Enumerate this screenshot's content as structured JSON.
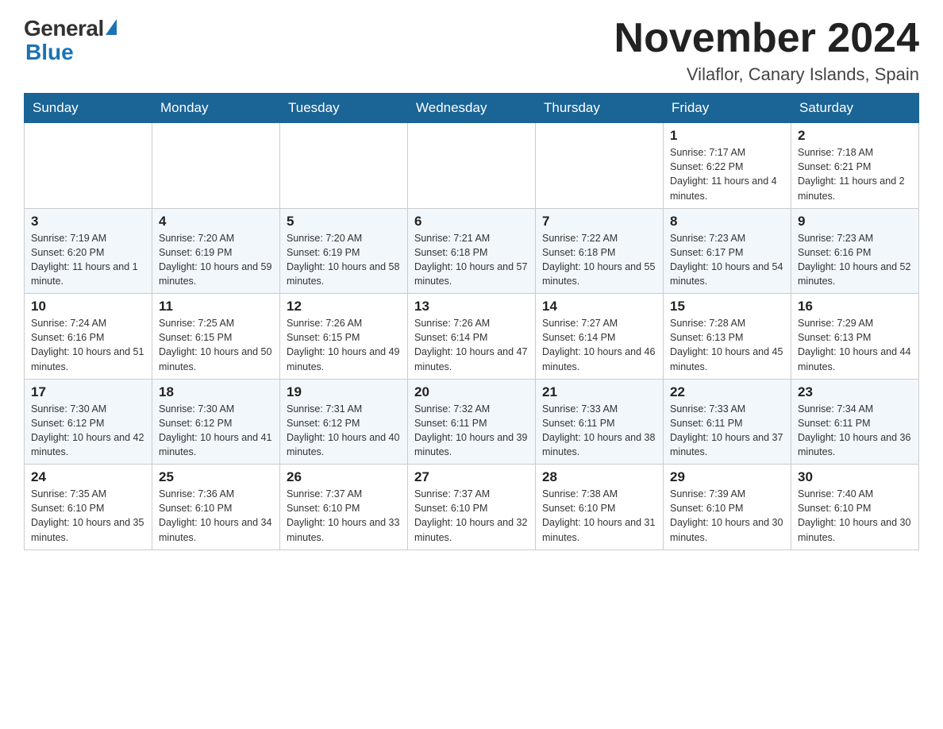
{
  "header": {
    "logo_general": "General",
    "logo_blue": "Blue",
    "title": "November 2024",
    "subtitle": "Vilaflor, Canary Islands, Spain"
  },
  "weekdays": [
    "Sunday",
    "Monday",
    "Tuesday",
    "Wednesday",
    "Thursday",
    "Friday",
    "Saturday"
  ],
  "weeks": [
    [
      {
        "day": "",
        "info": ""
      },
      {
        "day": "",
        "info": ""
      },
      {
        "day": "",
        "info": ""
      },
      {
        "day": "",
        "info": ""
      },
      {
        "day": "",
        "info": ""
      },
      {
        "day": "1",
        "info": "Sunrise: 7:17 AM\nSunset: 6:22 PM\nDaylight: 11 hours and 4 minutes."
      },
      {
        "day": "2",
        "info": "Sunrise: 7:18 AM\nSunset: 6:21 PM\nDaylight: 11 hours and 2 minutes."
      }
    ],
    [
      {
        "day": "3",
        "info": "Sunrise: 7:19 AM\nSunset: 6:20 PM\nDaylight: 11 hours and 1 minute."
      },
      {
        "day": "4",
        "info": "Sunrise: 7:20 AM\nSunset: 6:19 PM\nDaylight: 10 hours and 59 minutes."
      },
      {
        "day": "5",
        "info": "Sunrise: 7:20 AM\nSunset: 6:19 PM\nDaylight: 10 hours and 58 minutes."
      },
      {
        "day": "6",
        "info": "Sunrise: 7:21 AM\nSunset: 6:18 PM\nDaylight: 10 hours and 57 minutes."
      },
      {
        "day": "7",
        "info": "Sunrise: 7:22 AM\nSunset: 6:18 PM\nDaylight: 10 hours and 55 minutes."
      },
      {
        "day": "8",
        "info": "Sunrise: 7:23 AM\nSunset: 6:17 PM\nDaylight: 10 hours and 54 minutes."
      },
      {
        "day": "9",
        "info": "Sunrise: 7:23 AM\nSunset: 6:16 PM\nDaylight: 10 hours and 52 minutes."
      }
    ],
    [
      {
        "day": "10",
        "info": "Sunrise: 7:24 AM\nSunset: 6:16 PM\nDaylight: 10 hours and 51 minutes."
      },
      {
        "day": "11",
        "info": "Sunrise: 7:25 AM\nSunset: 6:15 PM\nDaylight: 10 hours and 50 minutes."
      },
      {
        "day": "12",
        "info": "Sunrise: 7:26 AM\nSunset: 6:15 PM\nDaylight: 10 hours and 49 minutes."
      },
      {
        "day": "13",
        "info": "Sunrise: 7:26 AM\nSunset: 6:14 PM\nDaylight: 10 hours and 47 minutes."
      },
      {
        "day": "14",
        "info": "Sunrise: 7:27 AM\nSunset: 6:14 PM\nDaylight: 10 hours and 46 minutes."
      },
      {
        "day": "15",
        "info": "Sunrise: 7:28 AM\nSunset: 6:13 PM\nDaylight: 10 hours and 45 minutes."
      },
      {
        "day": "16",
        "info": "Sunrise: 7:29 AM\nSunset: 6:13 PM\nDaylight: 10 hours and 44 minutes."
      }
    ],
    [
      {
        "day": "17",
        "info": "Sunrise: 7:30 AM\nSunset: 6:12 PM\nDaylight: 10 hours and 42 minutes."
      },
      {
        "day": "18",
        "info": "Sunrise: 7:30 AM\nSunset: 6:12 PM\nDaylight: 10 hours and 41 minutes."
      },
      {
        "day": "19",
        "info": "Sunrise: 7:31 AM\nSunset: 6:12 PM\nDaylight: 10 hours and 40 minutes."
      },
      {
        "day": "20",
        "info": "Sunrise: 7:32 AM\nSunset: 6:11 PM\nDaylight: 10 hours and 39 minutes."
      },
      {
        "day": "21",
        "info": "Sunrise: 7:33 AM\nSunset: 6:11 PM\nDaylight: 10 hours and 38 minutes."
      },
      {
        "day": "22",
        "info": "Sunrise: 7:33 AM\nSunset: 6:11 PM\nDaylight: 10 hours and 37 minutes."
      },
      {
        "day": "23",
        "info": "Sunrise: 7:34 AM\nSunset: 6:11 PM\nDaylight: 10 hours and 36 minutes."
      }
    ],
    [
      {
        "day": "24",
        "info": "Sunrise: 7:35 AM\nSunset: 6:10 PM\nDaylight: 10 hours and 35 minutes."
      },
      {
        "day": "25",
        "info": "Sunrise: 7:36 AM\nSunset: 6:10 PM\nDaylight: 10 hours and 34 minutes."
      },
      {
        "day": "26",
        "info": "Sunrise: 7:37 AM\nSunset: 6:10 PM\nDaylight: 10 hours and 33 minutes."
      },
      {
        "day": "27",
        "info": "Sunrise: 7:37 AM\nSunset: 6:10 PM\nDaylight: 10 hours and 32 minutes."
      },
      {
        "day": "28",
        "info": "Sunrise: 7:38 AM\nSunset: 6:10 PM\nDaylight: 10 hours and 31 minutes."
      },
      {
        "day": "29",
        "info": "Sunrise: 7:39 AM\nSunset: 6:10 PM\nDaylight: 10 hours and 30 minutes."
      },
      {
        "day": "30",
        "info": "Sunrise: 7:40 AM\nSunset: 6:10 PM\nDaylight: 10 hours and 30 minutes."
      }
    ]
  ]
}
